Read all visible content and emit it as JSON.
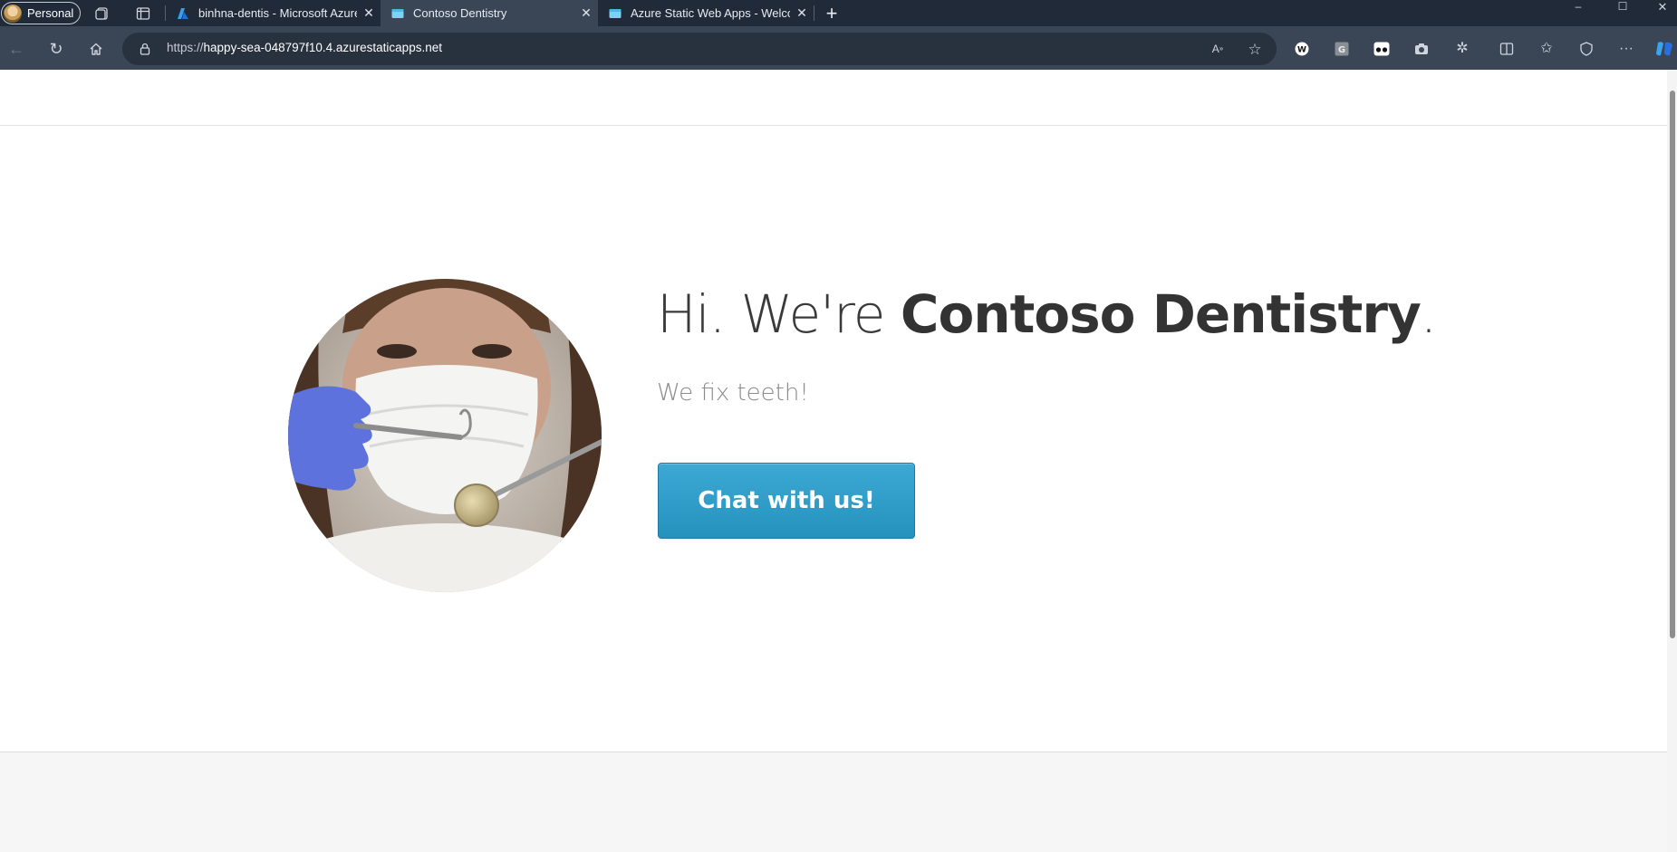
{
  "browser": {
    "profile_label": "Personal",
    "tabs": [
      {
        "title": "binhna-dentis - Microsoft Azure",
        "active": false
      },
      {
        "title": "Contoso Dentistry",
        "active": true
      },
      {
        "title": "Azure Static Web Apps - Welcome",
        "active": false
      }
    ],
    "new_tab_symbol": "+",
    "url_prefix": "https://",
    "url_host": "happy-sea-048797f10.4.azurestaticapps.net",
    "window_controls": {
      "minimize": "–",
      "maximize": "☐",
      "close": "✕"
    }
  },
  "page": {
    "headline_prefix": "Hi. We're ",
    "headline_brand": "Contoso Dentistry",
    "headline_suffix": ".",
    "tagline": "We fix teeth!",
    "cta_label": "Chat with us!"
  },
  "colors": {
    "chrome_dark": "#202a38",
    "chrome_toolbar": "#3a4556",
    "cta_blue": "#2b9bc9",
    "headline_text": "#333333",
    "tagline_text": "#8b8b8b"
  }
}
